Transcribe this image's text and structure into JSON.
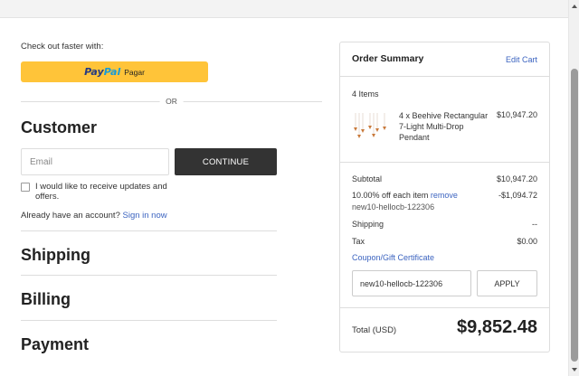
{
  "express_checkout": {
    "heading": "Check out faster with:",
    "paypal": {
      "brand_pay": "Pay",
      "brand_pal": "Pal",
      "label": "Pagar"
    },
    "separator": "OR"
  },
  "customer": {
    "title": "Customer",
    "email_placeholder": "Email",
    "email_value": "",
    "continue_label": "CONTINUE",
    "optin_label": "I would like to receive updates and offers.",
    "optin_checked": false,
    "account_prompt": "Already have an account?",
    "signin_label": "Sign in now"
  },
  "sections": {
    "shipping": "Shipping",
    "billing": "Billing",
    "payment": "Payment"
  },
  "order_summary": {
    "title": "Order Summary",
    "edit_cart": "Edit Cart",
    "items_count": "4 Items",
    "item": {
      "name": "4 x Beehive Rectangular 7-Light Multi-Drop Pendant",
      "price": "$10,947.20"
    },
    "subtotal_label": "Subtotal",
    "subtotal_value": "$10,947.20",
    "discount_label": "10.00% off each item",
    "discount_remove": "remove",
    "discount_value": "-$1,094.72",
    "discount_code": "new10-hellocb-122306",
    "shipping_label": "Shipping",
    "shipping_value": "--",
    "tax_label": "Tax",
    "tax_value": "$0.00",
    "coupon_link": "Coupon/Gift Certificate",
    "coupon_input_value": "new10-hellocb-122306",
    "apply_label": "APPLY",
    "total_label": "Total (USD)",
    "total_value": "$9,852.48"
  },
  "colors": {
    "paypal_yellow": "#ffc439",
    "paypal_navy": "#253b80",
    "paypal_blue": "#179bd7",
    "link_blue": "#3c64c0",
    "button_dark": "#333333"
  }
}
